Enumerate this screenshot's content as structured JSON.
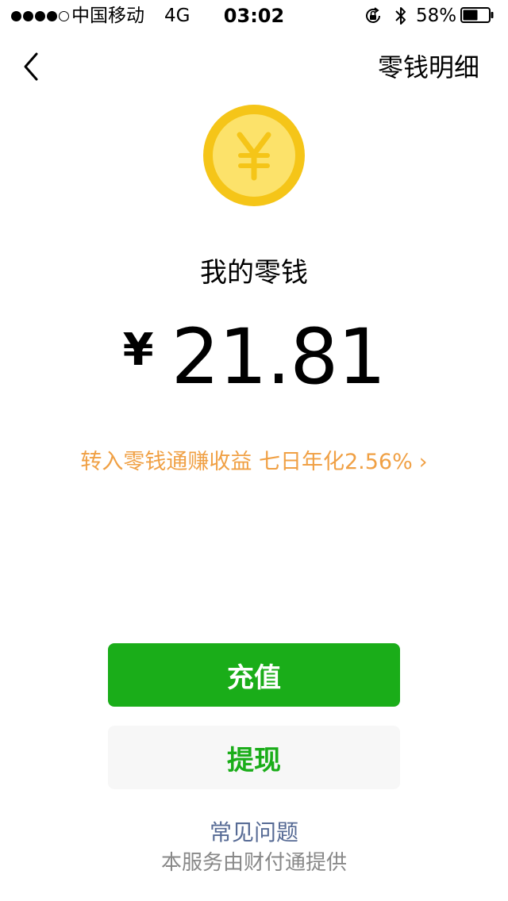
{
  "status_bar": {
    "signal_bars_filled": 4,
    "signal_bars_total": 5,
    "carrier": "中国移动",
    "network": "4G",
    "time": "03:02",
    "battery_percent": "58%",
    "battery_level": 0.58
  },
  "nav": {
    "back_icon": "chevron-left-icon",
    "title_link": "零钱明细"
  },
  "wallet": {
    "coin_icon": "yuan-coin-icon",
    "title": "我的零钱",
    "currency_symbol": "¥",
    "amount": "21.81",
    "promo_text": "转入零钱通赚收益 七日年化2.56%",
    "promo_chevron": "›"
  },
  "actions": {
    "recharge_label": "充值",
    "withdraw_label": "提现"
  },
  "footer": {
    "faq_label": "常见问题",
    "provider_text": "本服务由财付通提供"
  },
  "colors": {
    "brand_green": "#1aad19",
    "promo_orange": "#f0a044",
    "link_blue": "#576b95",
    "coin_outer": "#f5c518",
    "coin_inner": "#fce26a"
  }
}
